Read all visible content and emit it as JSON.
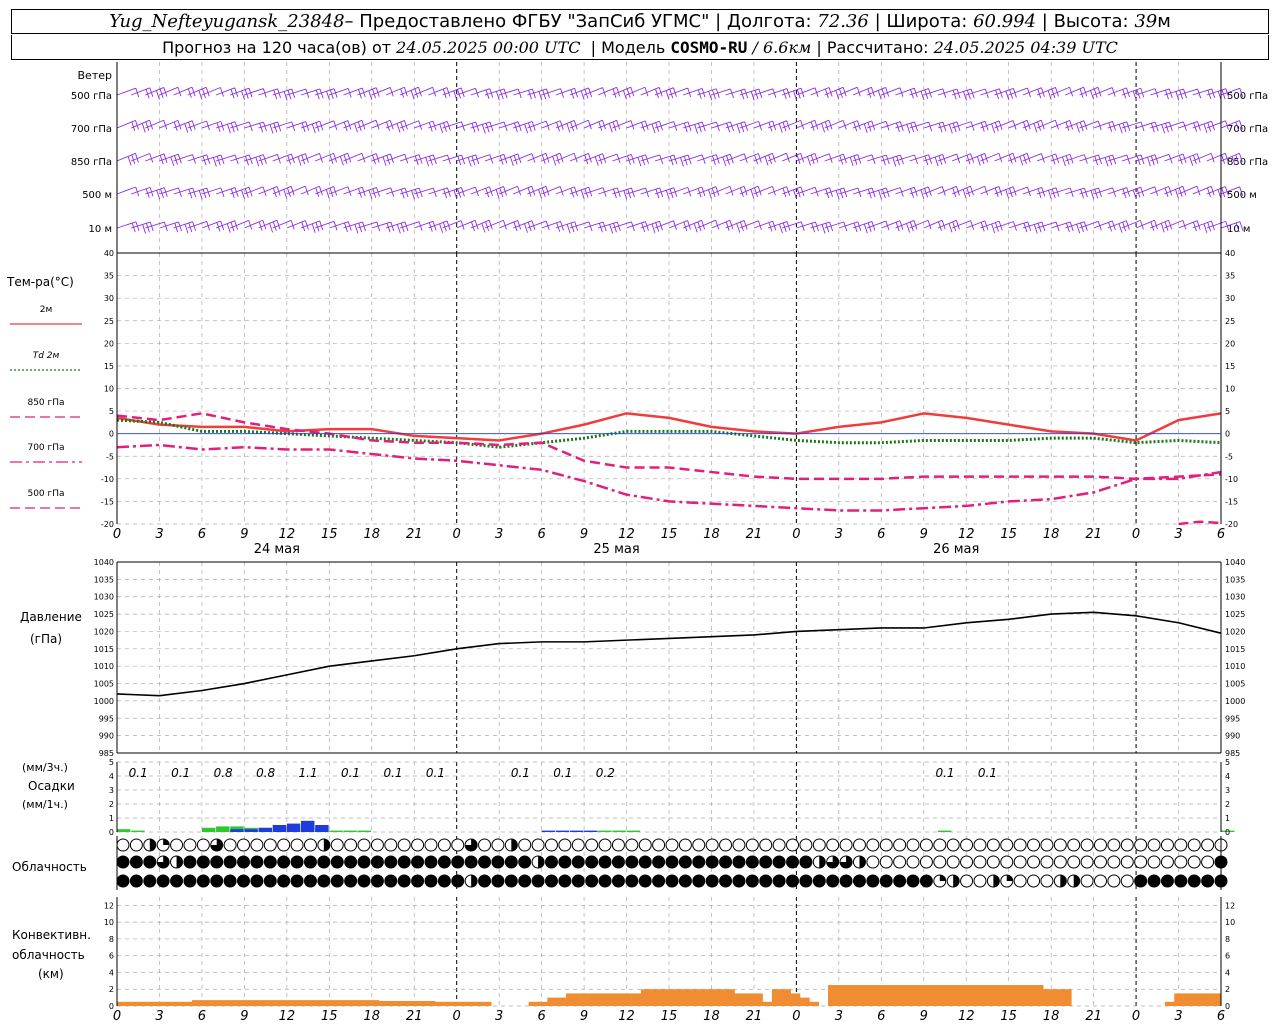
{
  "header": {
    "station": "Yug_Nefteyugansk_23848",
    "provided": " – Предоставлено ФГБУ \"ЗапСиб УГМС\"",
    "lon_label": "| Долгота:",
    "lon": "72.36",
    "lat_label": "| Широта:",
    "lat": "60.994",
    "alt_label": "| Высота:",
    "alt": "39",
    "alt_unit": "м",
    "forecast_label": "Прогноз на 120 часа(ов) от",
    "forecast_time": "24.05.2025 00:00 UTC",
    "model_label": "| Модель",
    "model": "COSMO-RU",
    "resolution": "/ 6.6км",
    "calc_label": "| Рассчитано:",
    "calc_time": "24.05.2025 04:39 UTC"
  },
  "panels": {
    "wind_title": "Ветер",
    "wind_levels": [
      "500 гПа",
      "700 гПа",
      "850 гПа",
      "500 м",
      "10 м"
    ],
    "temp_title": "Тем-ра(°С)",
    "pressure_title": "Давление",
    "pressure_unit": "(гПа)",
    "precip_unit3": "(мм/3ч.)",
    "precip_title": "Осадки",
    "precip_unit1": "(мм/1ч.)",
    "cloud_title": "Облачность",
    "conv_title1": "Конвективн.",
    "conv_title2": "облачность",
    "conv_unit": "(км)"
  },
  "colors": {
    "wind": "#8a2be2",
    "t2m": "#f03c3c",
    "td2m": "#1a7a1a",
    "t850": "#e0207a",
    "t700": "#e0207a",
    "t500": "#e0207a",
    "pressure": "#000000",
    "precip_green": "#2ec82e",
    "precip_blue": "#1e3cdc",
    "convective": "#f08c32"
  },
  "time_axis": {
    "hour_labels": [
      "0",
      "3",
      "6",
      "9",
      "12",
      "15",
      "18",
      "21",
      "0",
      "3",
      "6",
      "9",
      "12",
      "15",
      "18",
      "21",
      "0",
      "3",
      "6",
      "9",
      "12",
      "15",
      "18",
      "21",
      "0",
      "3",
      "6"
    ],
    "day_labels": [
      "24 мая",
      "25 мая",
      "26 мая"
    ]
  },
  "chart_data": [
    {
      "type": "line",
      "name": "temperature",
      "y_ticks": [
        40,
        35,
        30,
        25,
        20,
        15,
        10,
        5,
        0,
        -5,
        -10,
        -15,
        -20
      ],
      "ylim": [
        -20,
        40
      ],
      "series": [
        {
          "name": "2м",
          "style": "solid",
          "x": [
            0,
            3,
            6,
            9,
            12,
            15,
            18,
            21,
            24,
            27,
            30,
            33,
            36,
            39,
            42,
            45,
            48,
            51,
            54,
            57,
            60,
            63,
            66,
            69,
            72,
            75,
            78
          ],
          "values": [
            3.5,
            2,
            1.5,
            1.5,
            0.5,
            1,
            1,
            -0.5,
            -1,
            -1.5,
            0,
            2,
            4.5,
            3.5,
            1.5,
            0.5,
            0,
            1.5,
            2.5,
            4.5,
            3.5,
            2,
            0.5,
            0,
            -1.5,
            3,
            4.5
          ]
        },
        {
          "name": "Td 2м",
          "style": "dotted",
          "x": [
            0,
            3,
            6,
            9,
            12,
            15,
            18,
            21,
            24,
            27,
            30,
            33,
            36,
            39,
            42,
            45,
            48,
            51,
            54,
            57,
            60,
            63,
            66,
            69,
            72,
            75,
            78
          ],
          "values": [
            3,
            2.5,
            0.5,
            0.5,
            0,
            -0.5,
            -1,
            -1.5,
            -2,
            -3,
            -2,
            -1,
            0.5,
            0.5,
            0.5,
            -0.5,
            -1.5,
            -2,
            -2,
            -1.5,
            -1.5,
            -1.5,
            -1,
            -1,
            -2,
            -1.5,
            -2
          ]
        },
        {
          "name": "850 гПа",
          "style": "dashed",
          "x": [
            0,
            3,
            6,
            9,
            12,
            15,
            18,
            21,
            24,
            27,
            30,
            33,
            36,
            39,
            42,
            45,
            48,
            51,
            54,
            57,
            60,
            63,
            66,
            69,
            72,
            75,
            78
          ],
          "values": [
            4,
            3,
            4.5,
            2.5,
            1,
            0,
            -1.5,
            -2,
            -2,
            -2.5,
            -2,
            -6,
            -7.5,
            -7.5,
            -8.5,
            -9.5,
            -10,
            -10,
            -10,
            -9.5,
            -9.5,
            -9.5,
            -9.5,
            -9.5,
            -10,
            -9.5,
            -9
          ]
        },
        {
          "name": "700 гПа",
          "style": "dashdot",
          "x": [
            0,
            3,
            6,
            9,
            12,
            15,
            18,
            21,
            24,
            27,
            30,
            33,
            36,
            39,
            42,
            45,
            48,
            51,
            54,
            57,
            60,
            63,
            66,
            69,
            72,
            75,
            78
          ],
          "values": [
            -3,
            -2.5,
            -3.5,
            -3,
            -3.5,
            -3.5,
            -4.5,
            -5.5,
            -6,
            -7,
            -8,
            -10.5,
            -13.5,
            -15,
            -15.5,
            -16,
            -16.5,
            -17,
            -17,
            -16.5,
            -16,
            -15,
            -14.5,
            -13,
            -10,
            -10,
            -8.5
          ]
        },
        {
          "name": "500 гПа",
          "style": "dashed",
          "x": [
            75,
            76.5,
            78
          ],
          "values": [
            -20,
            -19.5,
            -19.8
          ]
        }
      ]
    },
    {
      "type": "line",
      "name": "pressure",
      "y_ticks": [
        1040,
        1035,
        1030,
        1025,
        1020,
        1015,
        1010,
        1005,
        1000,
        995,
        990,
        985
      ],
      "ylim": [
        985,
        1040
      ],
      "series": [
        {
          "name": "Давление",
          "x": [
            0,
            3,
            6,
            9,
            12,
            15,
            18,
            21,
            24,
            27,
            30,
            33,
            36,
            39,
            42,
            45,
            48,
            51,
            54,
            57,
            60,
            63,
            66,
            69,
            72,
            75,
            78
          ],
          "values": [
            1002,
            1001.5,
            1003,
            1005,
            1007.5,
            1010,
            1011.5,
            1013,
            1015,
            1016.5,
            1017,
            1017,
            1017.5,
            1018,
            1018.5,
            1019,
            1020,
            1020.5,
            1021,
            1021,
            1022.5,
            1023.5,
            1025,
            1025.5,
            1024.5,
            1022.5,
            1019.5
          ]
        }
      ]
    },
    {
      "type": "bar",
      "name": "precipitation",
      "y_ticks": [
        5,
        4,
        3,
        2,
        1,
        0
      ],
      "ylim": [
        0,
        5
      ],
      "labels_3h": {
        "x": [
          1.5,
          4.5,
          7.5,
          10.5,
          13.5,
          16.5,
          19.5,
          22.5,
          28.5,
          31.5,
          34.5,
          58.5,
          61.5
        ],
        "values": [
          "0.1",
          "0.1",
          "0.8",
          "0.8",
          "1.1",
          "0.1",
          "0.1",
          "0.1",
          "0.1",
          "0.1",
          "0.2",
          "0.1",
          "0.1"
        ]
      },
      "green_x": [
        0,
        1,
        6,
        7,
        8,
        9,
        10,
        11,
        12,
        13,
        14,
        15,
        16,
        17,
        34,
        35,
        36,
        58,
        78
      ],
      "green_values": [
        0.2,
        0.1,
        0.3,
        0.4,
        0.4,
        0.3,
        0.3,
        0.3,
        0.4,
        0.3,
        0.2,
        0.1,
        0.1,
        0.1,
        0.1,
        0.1,
        0.1,
        0.1,
        0.1
      ],
      "blue_x": [
        8,
        9,
        10,
        11,
        12,
        13,
        14,
        30,
        31,
        32,
        33
      ],
      "blue_values": [
        0.2,
        0.2,
        0.3,
        0.5,
        0.6,
        0.8,
        0.5,
        0.1,
        0.1,
        0.1,
        0.1
      ]
    },
    {
      "type": "bar",
      "name": "convective_cloud",
      "y_ticks": [
        12,
        10,
        8,
        6,
        4,
        2,
        0
      ],
      "ylim": [
        0,
        13
      ],
      "x": [
        0,
        1,
        2,
        3,
        4,
        5,
        6,
        7,
        8,
        9,
        10,
        11,
        12,
        13,
        14,
        15,
        16,
        17,
        18,
        19,
        20,
        21,
        22,
        23,
        24,
        25,
        26,
        27,
        28,
        29,
        30,
        31,
        32,
        33,
        34,
        35,
        36,
        37,
        38,
        39,
        40,
        41,
        42,
        43,
        44,
        45,
        46,
        47,
        48,
        49,
        50,
        51,
        52,
        53,
        54,
        55,
        56,
        57,
        58,
        59,
        60,
        61,
        62,
        63,
        64,
        65,
        66,
        67,
        68,
        69,
        70,
        71,
        72,
        73,
        74,
        75,
        76,
        77
      ],
      "values": [
        0.5,
        0.5,
        0.5,
        0.5,
        0.5,
        0.5,
        0.5,
        0.5,
        0.7,
        0.7,
        0.7,
        0.7,
        0.7,
        0.7,
        0.7,
        0.7,
        0.7,
        0.7,
        0.7,
        0.7,
        0.7,
        0.7,
        0.7,
        0.7,
        0.7,
        0.7,
        0.7,
        0.7,
        0.6,
        0.6,
        0.6,
        0.6,
        0.6,
        0.6,
        0.5,
        0.5,
        0.5,
        0.5,
        0.5,
        0.5,
        0,
        0,
        0,
        0,
        0.5,
        0.5,
        1,
        1,
        1.5,
        1.5,
        1.5,
        1.5,
        1.5,
        1.5,
        1.5,
        1.5,
        2,
        2,
        2,
        2,
        2,
        2,
        2,
        2,
        2,
        2,
        1.5,
        1.5,
        1.5,
        0.5,
        2,
        2,
        1.5,
        1,
        0.5,
        0,
        2.5,
        2.5,
        2.5,
        2.5,
        2.5,
        2.5,
        2.5,
        2.5,
        2.5,
        2.5,
        2.5,
        2.5,
        2.5,
        2.5,
        2.5,
        2.5,
        2.5,
        2.5,
        2.5,
        2.5,
        2.5,
        2.5,
        2.5,
        2,
        2,
        2,
        0,
        0,
        0,
        0,
        0,
        0,
        0,
        0,
        0,
        0,
        0.5,
        1.5,
        1.5,
        1.5,
        1.5,
        1.5
      ]
    }
  ],
  "cloud_rows": [
    "OOHQOOOTOOOOOOOHOOOOOOOOOOTOOHOOOOOOOOOOOOOOOOOOOOOOOOOOOOOOOOOOOOOOOOOOOOOOOOOOOOOOOOOOOOOOOOOOOOOOOOOOOOOOOOOOOOOOOOOOOOOOOOOOOOOOOOOOOOOOOOOOOOOOOOOOOOOOOOOOOOOOOOOOOOOOOOO",
    "FFFTHFFFFFFFFFFFFFFFFFFFFFFFFFFHFFFFFFFFFFFFFFFFFFFFHTTHOOOOOOOOOOOOOOOOOOOOOOOOOOFFFFFHQFQOOOFFFFFFFFFFFFQOOHOOOFFFFFFFFFFFFFOOOOOOOOOOOFFFFFTFFFF",
    "FFFFFFFFFFFFFFFFFFFFFFFFFFHFFFFFFFFFFFFFFFFFFFFFFFFFFFFFFFFFFQHOOHQOOOHHOOOOFFFFFFFFHOOHOOFFFFFHFFFFFFFFFFFFFFFFFFFFFFFFFFFFFFFFF"
  ]
}
